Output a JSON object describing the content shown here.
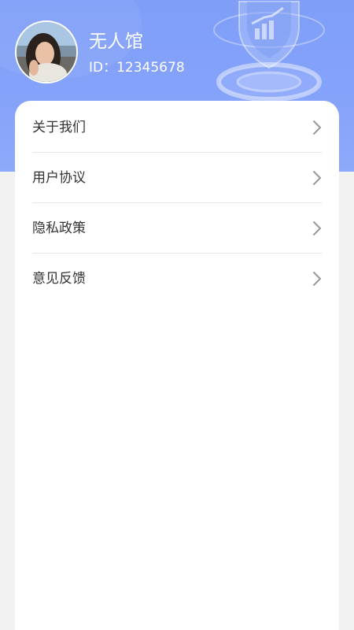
{
  "profile": {
    "name": "无人馆",
    "id_text": "ID：12345678"
  },
  "menu": [
    {
      "label": "关于我们",
      "icon": "chevron-right-icon"
    },
    {
      "label": "用户协议",
      "icon": "chevron-right-icon"
    },
    {
      "label": "隐私政策",
      "icon": "chevron-right-icon"
    },
    {
      "label": "意见反馈",
      "icon": "chevron-right-icon"
    }
  ],
  "colors": {
    "header": "#7e9ef8",
    "background": "#f2f2f2",
    "card": "#ffffff",
    "text": "#333333",
    "chevron": "#999999"
  }
}
